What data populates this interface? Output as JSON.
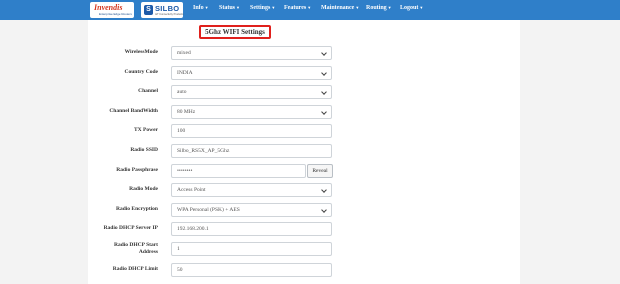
{
  "brand": {
    "logo1_main": "Invendis",
    "logo1_sub": "Enterprise Edge Routers",
    "logo2_mark": "S",
    "logo2_main": "SILBO",
    "logo2_sub": "IoT Connectivity Products"
  },
  "nav": {
    "items": [
      "Info",
      "Status",
      "Settings",
      "Features",
      "Maintenance",
      "Routing",
      "Logout"
    ]
  },
  "page": {
    "title": "5Ghz WIFI Settings"
  },
  "form": {
    "wireless_mode": {
      "label": "WirelessMode",
      "value": "mixed"
    },
    "country_code": {
      "label": "Country Code",
      "value": "INDIA"
    },
    "channel": {
      "label": "Channel",
      "value": "auto"
    },
    "channel_bandwidth": {
      "label": "Channel BandWidth",
      "value": "80 MHz"
    },
    "tx_power": {
      "label": "TX Power",
      "value": "100"
    },
    "radio_ssid": {
      "label": "Radio SSID",
      "value": "Silbo_RS5X_AP_5Ghz"
    },
    "radio_passphrase": {
      "label": "Radio Passphrase",
      "value": "••••••••",
      "reveal_label": "Reveal"
    },
    "radio_mode": {
      "label": "Radio Mode",
      "value": "Access Point"
    },
    "radio_encryption": {
      "label": "Radio Encryption",
      "value": "WPA Personal (PSK) + AES"
    },
    "dhcp_server_ip": {
      "label": "Radio DHCP Server IP",
      "value": "192.168.200.1"
    },
    "dhcp_start": {
      "label_line1": "Radio DHCP Start",
      "label_line2": "Address",
      "value": "1"
    },
    "dhcp_limit": {
      "label": "Radio DHCP Limit",
      "value": "50"
    }
  },
  "colors": {
    "navbar": "#2f7fc9",
    "title_border": "#e0201c"
  }
}
